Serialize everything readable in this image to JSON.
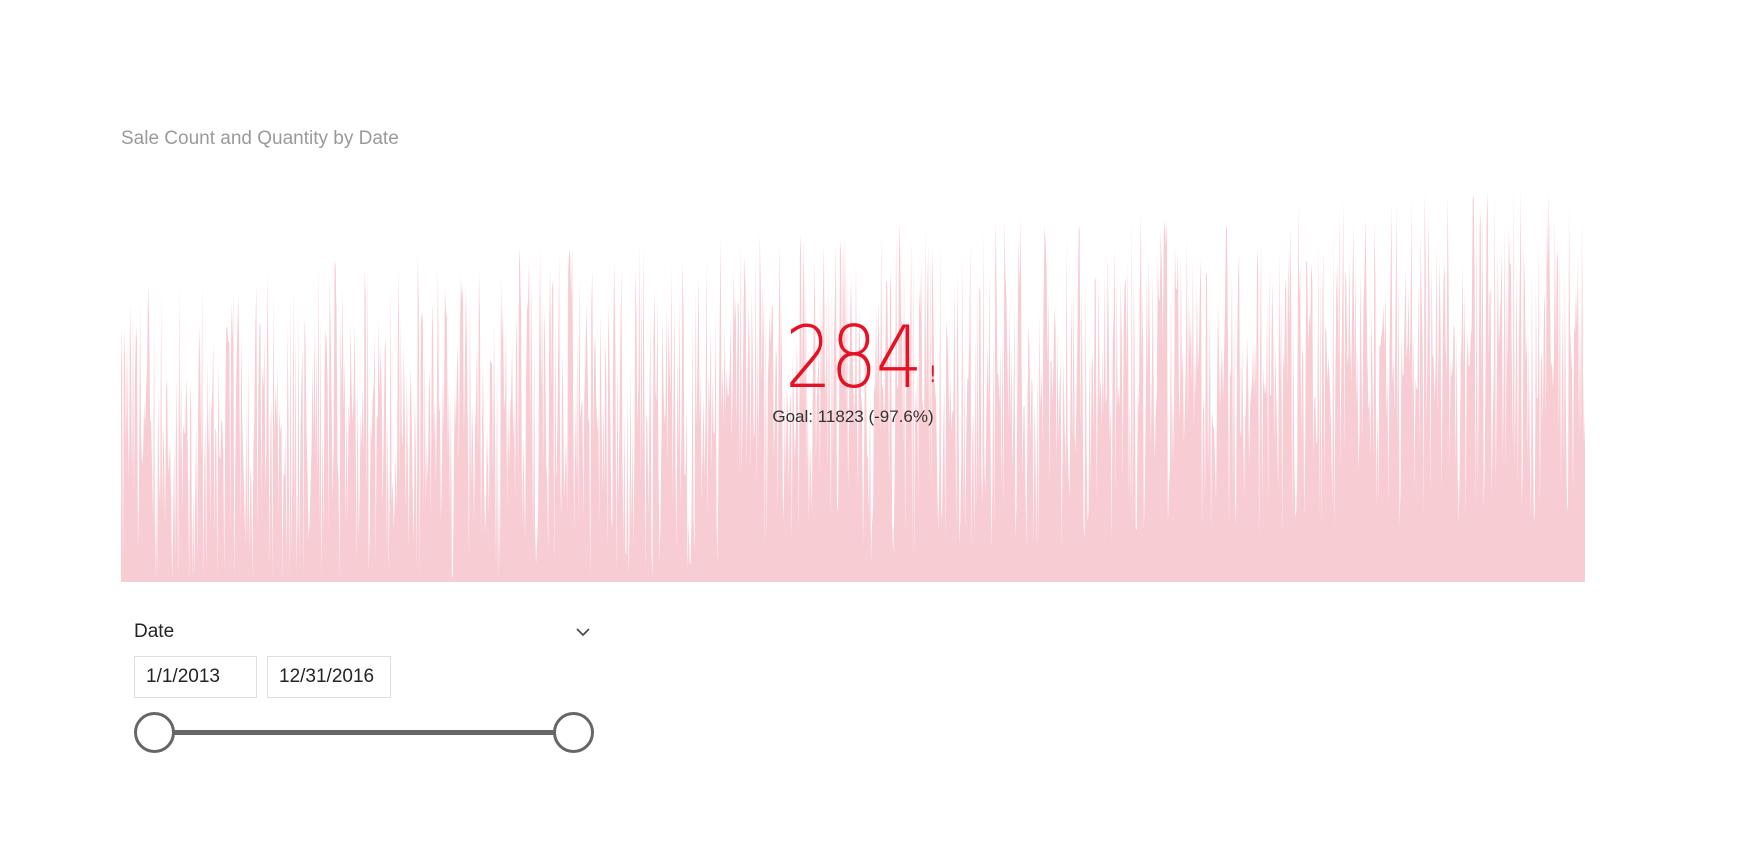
{
  "kpi": {
    "title": "Sale Count and Quantity by Date",
    "value": "284",
    "alert_symbol": "!",
    "goal_text": "Goal: 11823 (-97.6%)",
    "value_color": "#e81123",
    "trend_color": "#f8ccd3"
  },
  "slicer": {
    "header": "Date",
    "start_date": "1/1/2013",
    "end_date": "12/31/2016",
    "range_start_fraction": 0,
    "range_end_fraction": 1,
    "icons": {
      "expand": "chevron-down-icon"
    }
  },
  "chart_data": {
    "type": "area",
    "series": [
      {
        "values": []
      }
    ]
  }
}
